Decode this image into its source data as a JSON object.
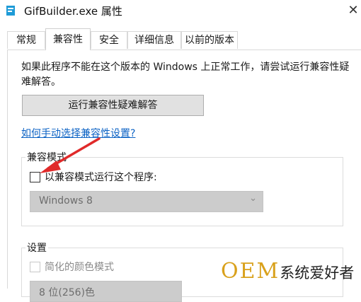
{
  "window": {
    "title": "GifBuilder.exe 属性",
    "close": "✕"
  },
  "tabs": [
    {
      "label": "常规"
    },
    {
      "label": "兼容性"
    },
    {
      "label": "安全"
    },
    {
      "label": "详细信息"
    },
    {
      "label": "以前的版本"
    }
  ],
  "active_tab": "兼容性",
  "compat": {
    "intro": "如果此程序不能在这个版本的 Windows 上正常工作，请尝试运行兼容性疑难解答。",
    "troubleshoot_button": "运行兼容性疑难解答",
    "manual_link": "如何手动选择兼容性设置?"
  },
  "compat_mode": {
    "group_label": "兼容模式",
    "checkbox_label": "以兼容模式运行这个程序:",
    "checked": false,
    "os_select_value": "Windows 8"
  },
  "settings": {
    "group_label": "设置",
    "reduced_color_label": "简化的颜色模式",
    "reduced_color_checked": false,
    "color_select_value": "8 位(256)色"
  },
  "colors": {
    "link": "#0b62c4",
    "arrow": "#e02a2a",
    "watermark_accent": "#d9a11c"
  },
  "watermark": {
    "brand": "OEM",
    "suffix": "系统爱好者"
  }
}
